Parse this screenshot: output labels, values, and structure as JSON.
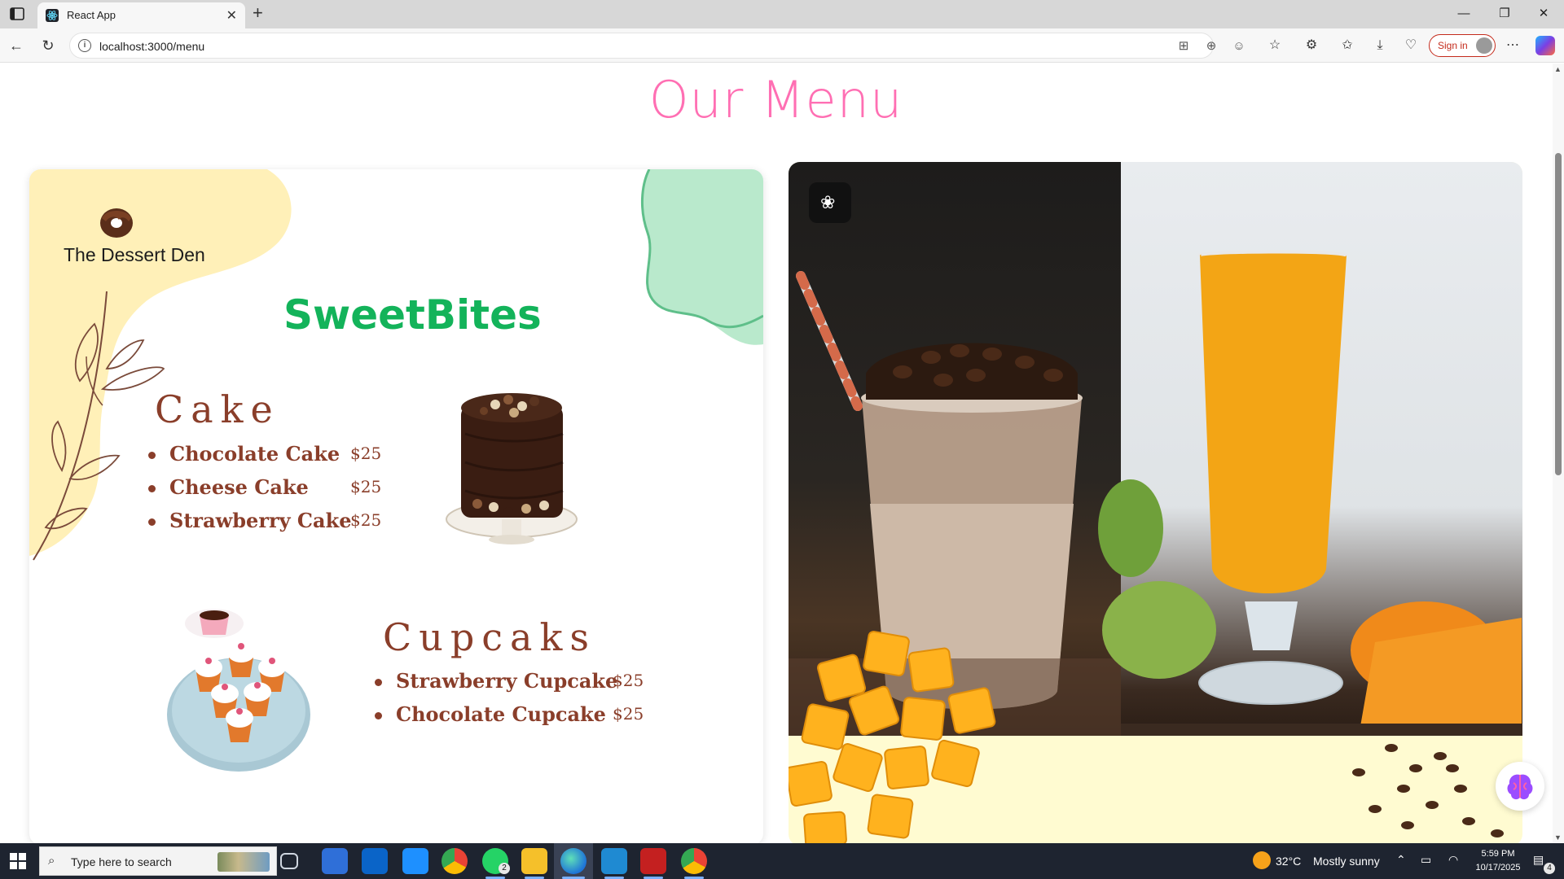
{
  "browser": {
    "tab_title": "React App",
    "url": "localhost:3000/menu",
    "signin_label": "Sign in"
  },
  "page": {
    "title": "Our Menu"
  },
  "menu_card": {
    "brand_name": "The Dessert Den",
    "headline": "SweetBites",
    "sections": [
      {
        "title": "Cake",
        "items": [
          {
            "name": "Chocolate Cake",
            "price": "$25"
          },
          {
            "name": "Cheese Cake",
            "price": "$25"
          },
          {
            "name": "Strawberry Cake",
            "price": "$25"
          }
        ]
      },
      {
        "title": "Cupcaks",
        "items": [
          {
            "name": "Strawberry Cupcake",
            "price": "$25"
          },
          {
            "name": "Chocolate Cupcake",
            "price": "$25"
          }
        ]
      }
    ]
  },
  "taskbar": {
    "search_placeholder": "Type here to search",
    "weather_temp": "32°C",
    "weather_text": "Mostly sunny",
    "time": "5:59 PM",
    "date": "10/17/2025",
    "whatsapp_badge": "2",
    "notification_badge": "4"
  },
  "colors": {
    "title_pink": "#ff6fb3",
    "headline_green": "#13b35a",
    "menu_brown": "#8a3e2a",
    "blob_yellow": "#fff0b8",
    "blob_green": "#b9e9cc"
  }
}
